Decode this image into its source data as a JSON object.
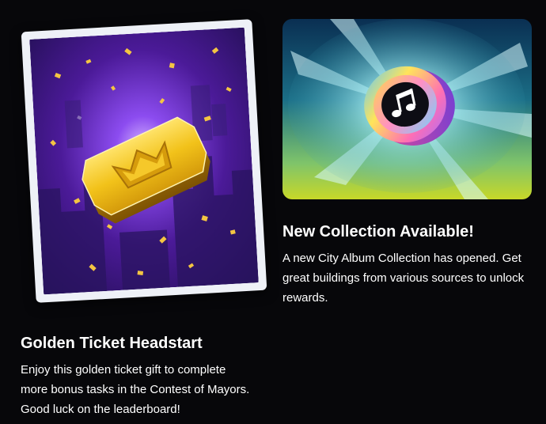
{
  "cards": [
    {
      "id": "golden-ticket",
      "title": "Golden Ticket Headstart",
      "description_lines": [
        "Enjoy this golden ticket gift to complete",
        "more bonus tasks in the Contest of Mayors.",
        "Good luck on the leaderboard!"
      ],
      "image_icon": "golden-ticket-crown-icon",
      "colors": {
        "frame": "#eef1f7",
        "background_top": "#5a1fa8",
        "background_glow": "#b98cff",
        "ticket_gold": "#f2c21a",
        "ticket_gold_dark": "#b78405"
      }
    },
    {
      "id": "new-collection",
      "title": "New Collection Available!",
      "description_lines": [
        "A new City Album Collection has opened. Get",
        "great buildings from various sources to unlock",
        "rewards."
      ],
      "image_icon": "music-note-coin-icon",
      "colors": {
        "background_top": "#0b3a5c",
        "background_glow": "#bfeff2",
        "background_bottom": "#c6d62a",
        "coin_rim_pink": "#ff6fb3",
        "coin_rim_yellow": "#ffe45a",
        "coin_rim_blue": "#58c9ff"
      }
    }
  ],
  "page": {
    "background": "#07070a"
  }
}
